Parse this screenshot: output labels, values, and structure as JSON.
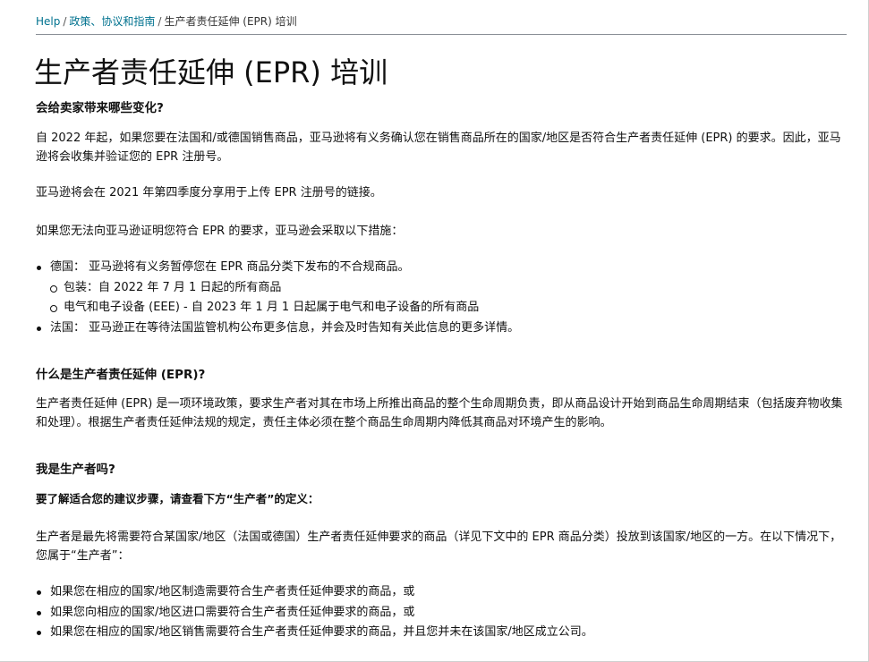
{
  "breadcrumb": {
    "items": [
      "Help",
      "政策、协议和指南"
    ],
    "current": "生产者责任延伸 (EPR) 培训",
    "separator": "/"
  },
  "page_title": "生产者责任延伸 (EPR) 培训",
  "section1": {
    "heading": "会给卖家带来哪些变化?",
    "p1": "自 2022 年起，如果您要在法国和/或德国销售商品，亚马逊将有义务确认您在销售商品所在的国家/地区是否符合生产者责任延伸 (EPR) 的要求。因此，亚马逊将会收集并验证您的 EPR 注册号。",
    "p2": "亚马逊将会在 2021 年第四季度分享用于上传 EPR 注册号的链接。",
    "p3": "如果您无法向亚马逊证明您符合 EPR 的要求，亚马逊会采取以下措施：",
    "bullets": [
      "德国：  亚马逊将有义务暂停您在 EPR 商品分类下发布的不合规商品。",
      "包装：自 2022 年 7 月 1 日起的所有商品",
      "电气和电子设备 (EEE) - 自 2023 年 1 月 1 日起属于电气和电子设备的所有商品",
      "法国：  亚马逊正在等待法国监管机构公布更多信息，并会及时告知有关此信息的更多详情。"
    ]
  },
  "section2": {
    "heading": "什么是生产者责任延伸 (EPR)?",
    "p1": "生产者责任延伸 (EPR) 是一项环境政策，要求生产者对其在市场上所推出商品的整个生命周期负责，即从商品设计开始到商品生命周期结束（包括废弃物收集和处理）。根据生产者责任延伸法规的规定，责任主体必须在整个商品生命周期内降低其商品对环境产生的影响。"
  },
  "section3": {
    "heading": "我是生产者吗?",
    "intro": "要了解适合您的建议步骤，请查看下方“生产者”的定义：",
    "p1": "生产者是最先将需要符合某国家/地区（法国或德国）生产者责任延伸要求的商品（详见下文中的 EPR 商品分类）投放到该国家/地区的一方。在以下情况下，您属于“生产者”：",
    "bullets": [
      "如果您在相应的国家/地区制造需要符合生产者责任延伸要求的商品，或",
      "如果您向相应的国家/地区进口需要符合生产者责任延伸要求的商品，或",
      "如果您在相应的国家/地区销售需要符合生产者责任延伸要求的商品，并且您并未在该国家/地区成立公司。"
    ]
  },
  "colors": {
    "link": "#00728f",
    "text": "#111111",
    "rule": "#8a8f96"
  }
}
